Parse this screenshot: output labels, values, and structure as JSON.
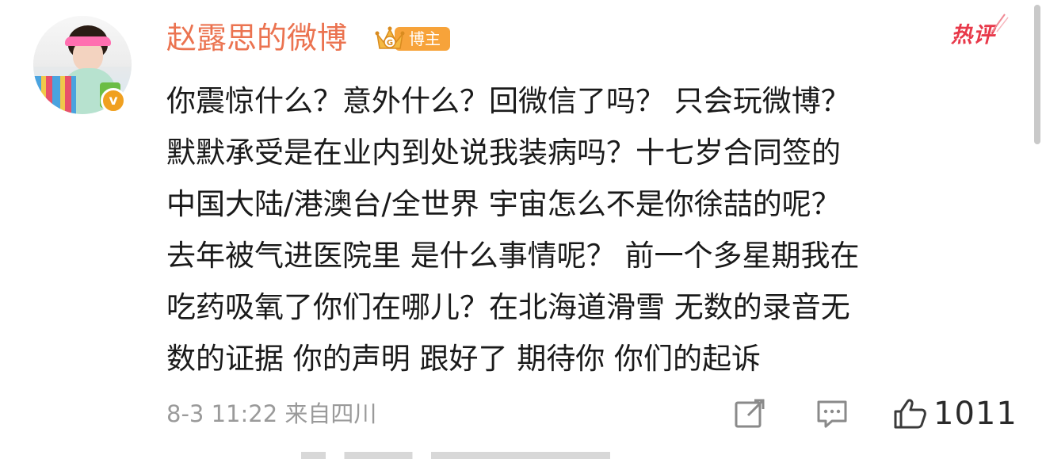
{
  "post": {
    "author": {
      "name": "赵露思的微博",
      "badge_label": "博主",
      "verified_mark": "v",
      "avatar_icon": "user-avatar-photo",
      "verified_icon": "verified-orange-v-icon"
    },
    "hot_label": "热评",
    "content_lines": [
      "你震惊什么？意外什么？回微信了吗？ 只会玩微博？",
      "默默承受是在业内到处说我装病吗？十七岁合同签的",
      "中国大陆/港澳台/全世界  宇宙怎么不是你徐喆的呢？",
      "去年被气进医院里 是什么事情呢？ 前一个多星期我在",
      "吃药吸氧了你们在哪儿？在北海道滑雪 无数的录音无",
      "数的证据 你的声明 跟好了 期待你 你们的起诉"
    ],
    "meta": {
      "timestamp": "8-3 11:22",
      "source": "来自四川"
    },
    "actions": {
      "share_icon": "share-edit-icon",
      "comment_icon": "comment-icon",
      "like_icon": "thumbs-up-icon",
      "like_count": "1011"
    }
  },
  "colors": {
    "username": "#eb7350",
    "hot_label": "#e8394a",
    "badge": "#f7a33a",
    "verified": "#f0a020",
    "meta_text": "#9a9a9a",
    "body_text": "#1a1a1a"
  }
}
